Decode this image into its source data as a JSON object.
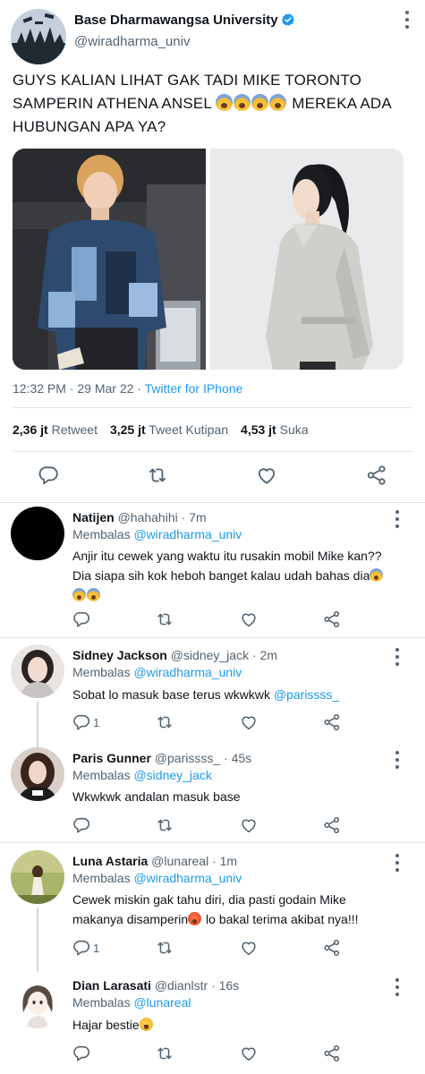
{
  "tweet": {
    "author_name": "Base Dharmawangsa University",
    "author_handle": "@wiradharma_univ",
    "text_part1": "GUYS KALIAN LIHAT GAK TADI MIKE TORONTO SAMPERIN ATHENA ANSEL ",
    "text_part2": " MEREKA ADA HUBUNGAN APA YA?",
    "time": "12:32 PM · 29 Mar 22 · ",
    "source": "Twitter for IPhone",
    "retweets": "2,36 jt",
    "retweets_label": "Retweet",
    "quotes": "3,25 jt",
    "quotes_label": "Tweet Kutipan",
    "likes": "4,53 jt",
    "likes_label": "Suka"
  },
  "replying_label": "Membalas ",
  "replies": [
    {
      "name": "Natijen",
      "handle": "@hahahihi",
      "time": "· 7m",
      "reply_to": "@wiradharma_univ",
      "text": "Anjir itu cewek yang waktu itu rusakin mobil Mike kan?? Dia siapa sih kok heboh banget kalau udah bahas dia",
      "reply_count": ""
    },
    {
      "name": "Sidney Jackson",
      "handle": "@sidney_jack",
      "time": "· 2m",
      "reply_to": "@wiradharma_univ",
      "text": "Sobat lo masuk base terus wkwkwk ",
      "mention": "@parissss_",
      "reply_count": "1"
    },
    {
      "name": "Paris Gunner",
      "handle": "@parissss_",
      "time": "· 45s",
      "reply_to": "@sidney_jack",
      "text": "Wkwkwk andalan masuk base",
      "reply_count": ""
    },
    {
      "name": "Luna Astaria",
      "handle": "@lunareal",
      "time": "· 1m",
      "reply_to": "@wiradharma_univ",
      "text_part1": "Cewek miskin gak tahu diri, dia pasti godain Mike makanya disamperin",
      "text_part2": " lo bakal terima akibat nya!!!",
      "reply_count": "1"
    },
    {
      "name": "Dian Larasati",
      "handle": "@dianlstr",
      "time": "· 16s",
      "reply_to": "@lunareal",
      "text": "Hajar bestie",
      "reply_count": ""
    }
  ],
  "colors": {
    "accent": "#1d9bf0",
    "text": "#0f1419",
    "muted": "#536471",
    "divider": "#e1e6ea"
  }
}
